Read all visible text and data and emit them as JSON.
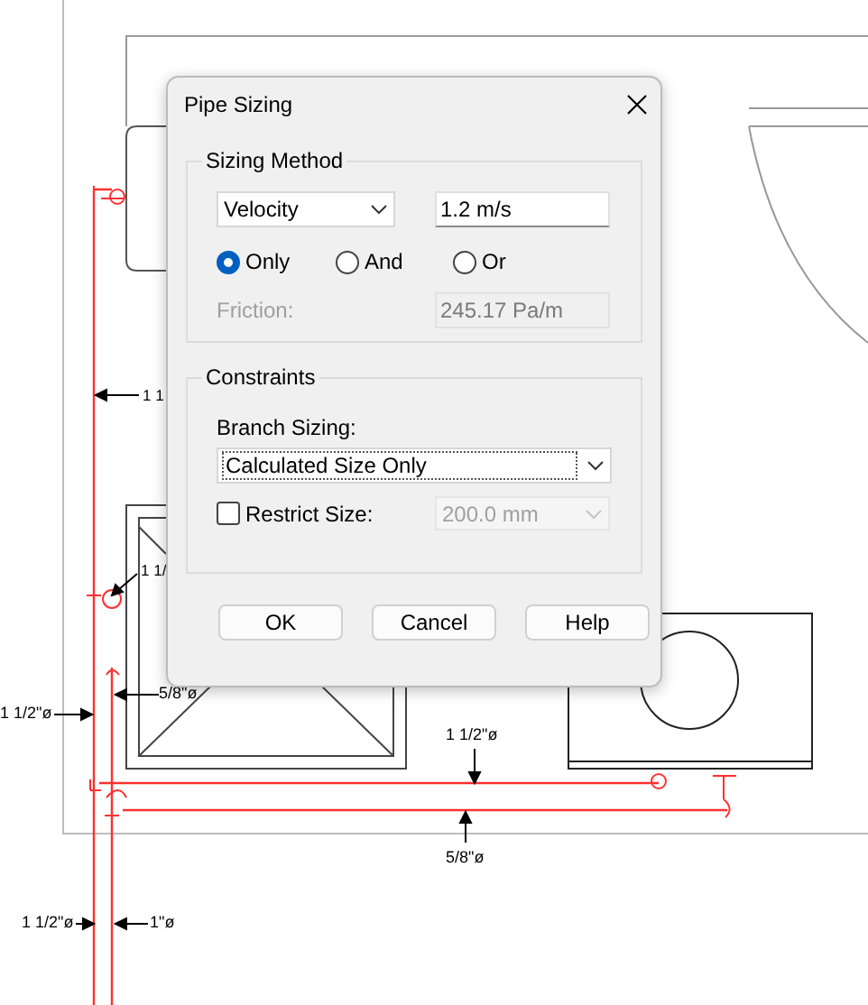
{
  "drawing": {
    "dimension_labels": [
      {
        "text": "1 1"
      },
      {
        "text": "1 1/"
      },
      {
        "text": "5/8\"ø"
      },
      {
        "text": "1 1/2\"ø"
      },
      {
        "text": "1 1/2\"ø"
      },
      {
        "text": "5/8\"ø"
      },
      {
        "text": "1 1/2\"ø"
      },
      {
        "text": "1\"ø"
      }
    ]
  },
  "dialog": {
    "title": "Pipe Sizing",
    "sizing_method": {
      "label": "Sizing Method",
      "method": {
        "value": "Velocity"
      },
      "value_field": {
        "value": "1.2 m/s"
      },
      "options": [
        {
          "label": "Only",
          "selected": true
        },
        {
          "label": "And",
          "selected": false
        },
        {
          "label": "Or",
          "selected": false
        }
      ],
      "friction": {
        "label": "Friction:",
        "value": "245.17 Pa/m",
        "disabled": true
      }
    },
    "constraints": {
      "label": "Constraints",
      "branch_sizing": {
        "label": "Branch Sizing:",
        "value": "Calculated Size Only"
      },
      "restrict_size": {
        "label": "Restrict Size:",
        "checked": false
      },
      "size": {
        "value": "200.0 mm",
        "disabled": true
      }
    },
    "buttons": [
      {
        "label": "OK"
      },
      {
        "label": "Cancel"
      },
      {
        "label": "Help"
      }
    ]
  }
}
